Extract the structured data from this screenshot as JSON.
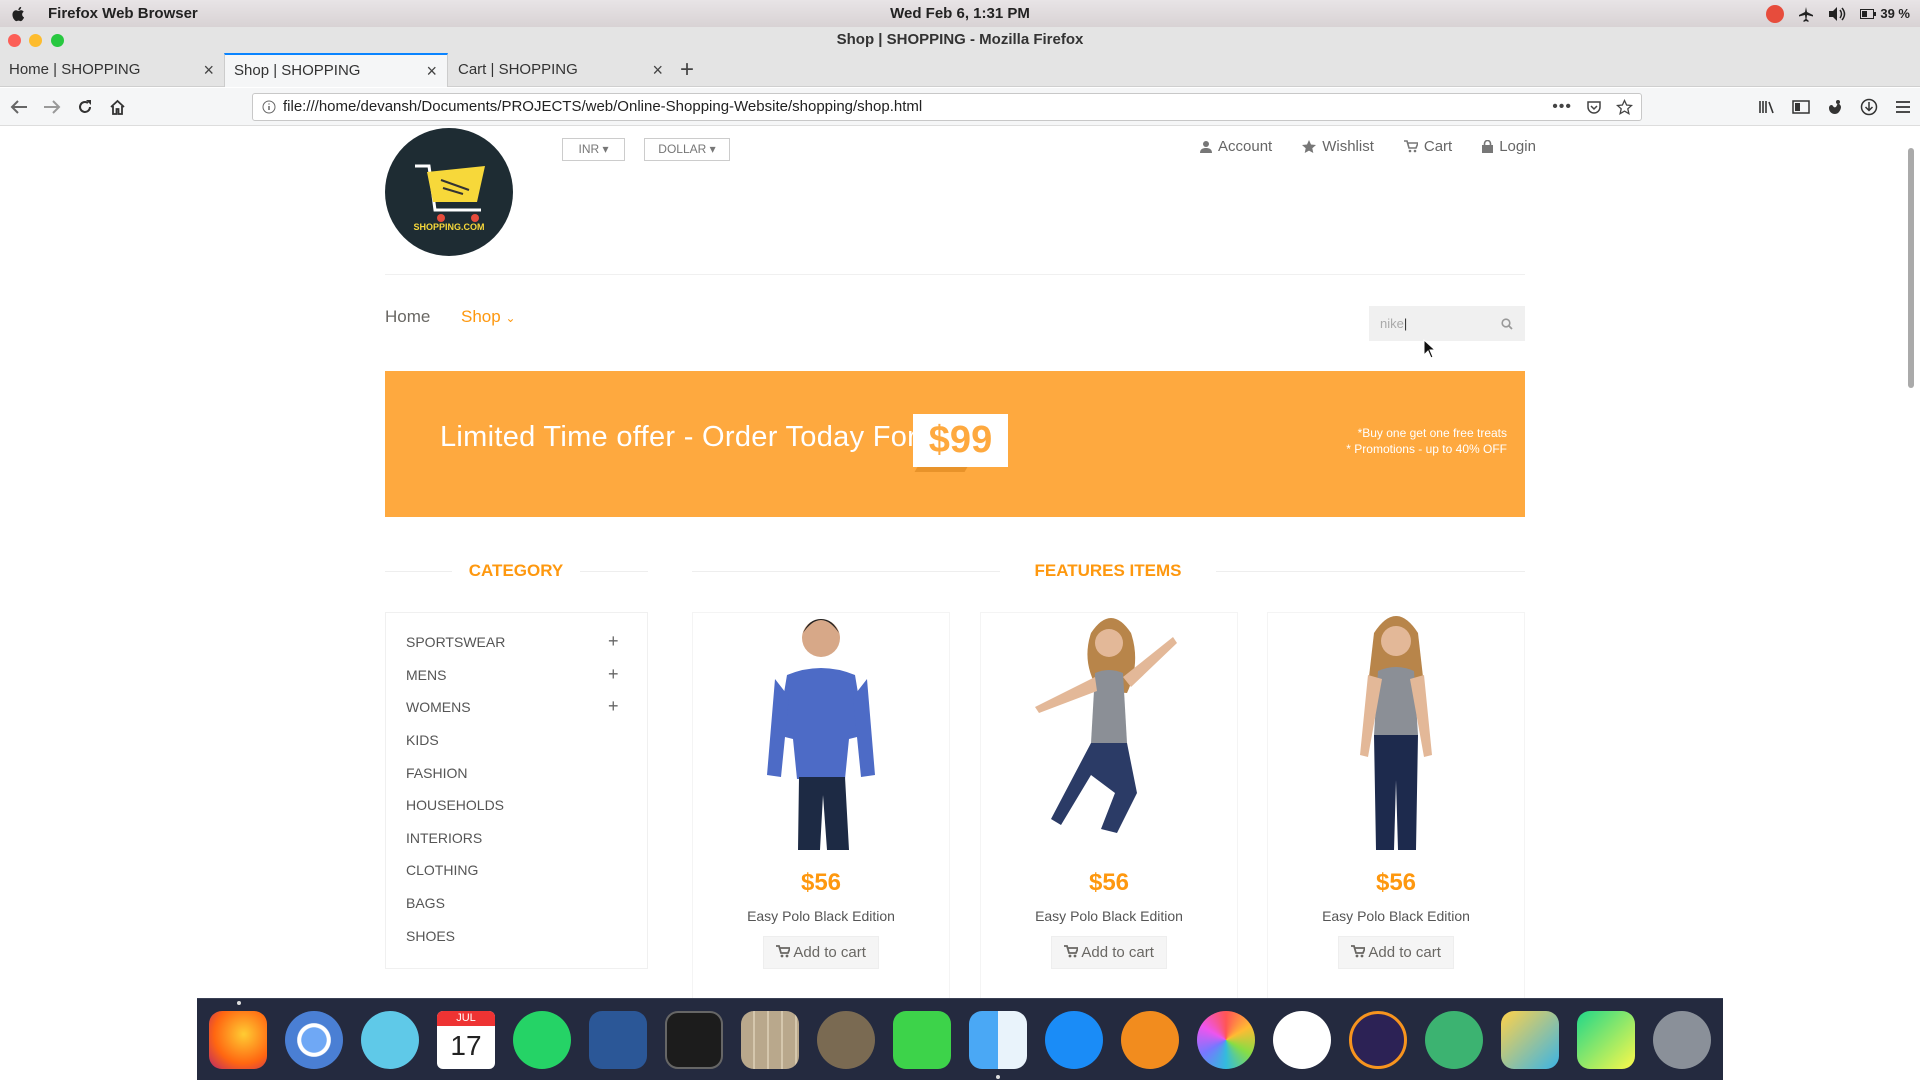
{
  "menubar": {
    "app_name": "Firefox Web Browser",
    "clock": "Wed Feb  6,  1:31 PM",
    "battery": "39 %"
  },
  "window": {
    "title": "Shop | SHOPPING - Mozilla Firefox"
  },
  "tabs": [
    {
      "label": "Home | SHOPPING"
    },
    {
      "label": "Shop | SHOPPING"
    },
    {
      "label": "Cart | SHOPPING"
    }
  ],
  "address_bar": {
    "url": "file:///home/devansh/Documents/PROJECTS/web/Online-Shopping-Website/shopping/shop.html"
  },
  "site": {
    "logo_text": "SHOPPING.COM",
    "currency": [
      {
        "label": "INR"
      },
      {
        "label": "DOLLAR"
      }
    ],
    "top_links": [
      {
        "label": "Account",
        "icon": "user-icon"
      },
      {
        "label": "Wishlist",
        "icon": "star-icon"
      },
      {
        "label": "Cart",
        "icon": "cart-icon"
      },
      {
        "label": "Login",
        "icon": "lock-icon"
      }
    ],
    "nav": {
      "home": "Home",
      "shop": "Shop"
    },
    "search": {
      "value": "nike"
    },
    "banner": {
      "headline": "Limited Time offer - Order Today For",
      "price": "$99",
      "promo_1": "*Buy one get one free treats",
      "promo_2": "* Promotions - up to 40% OFF"
    },
    "category_title": "CATEGORY",
    "features_title": "FEATURES ITEMS",
    "categories": [
      {
        "label": "SPORTSWEAR",
        "expandable": true
      },
      {
        "label": "MENS",
        "expandable": true
      },
      {
        "label": "WOMENS",
        "expandable": true
      },
      {
        "label": "KIDS",
        "expandable": false
      },
      {
        "label": "FASHION",
        "expandable": false
      },
      {
        "label": "HOUSEHOLDS",
        "expandable": false
      },
      {
        "label": "INTERIORS",
        "expandable": false
      },
      {
        "label": "CLOTHING",
        "expandable": false
      },
      {
        "label": "BAGS",
        "expandable": false
      },
      {
        "label": "SHOES",
        "expandable": false
      }
    ],
    "plus": "+",
    "products": [
      {
        "price": "$56",
        "name": "Easy Polo Black Edition",
        "button": "Add to cart"
      },
      {
        "price": "$56",
        "name": "Easy Polo Black Edition",
        "button": "Add to cart"
      },
      {
        "price": "$56",
        "name": "Easy Polo Black Edition",
        "button": "Add to cart"
      }
    ]
  },
  "dock": {
    "calendar_month": "JUL",
    "calendar_day": "17"
  },
  "colors": {
    "accent": "#fe980f",
    "banner": "#fea93f",
    "tab_active": "#0a84ff",
    "dock": "#242a3f"
  }
}
